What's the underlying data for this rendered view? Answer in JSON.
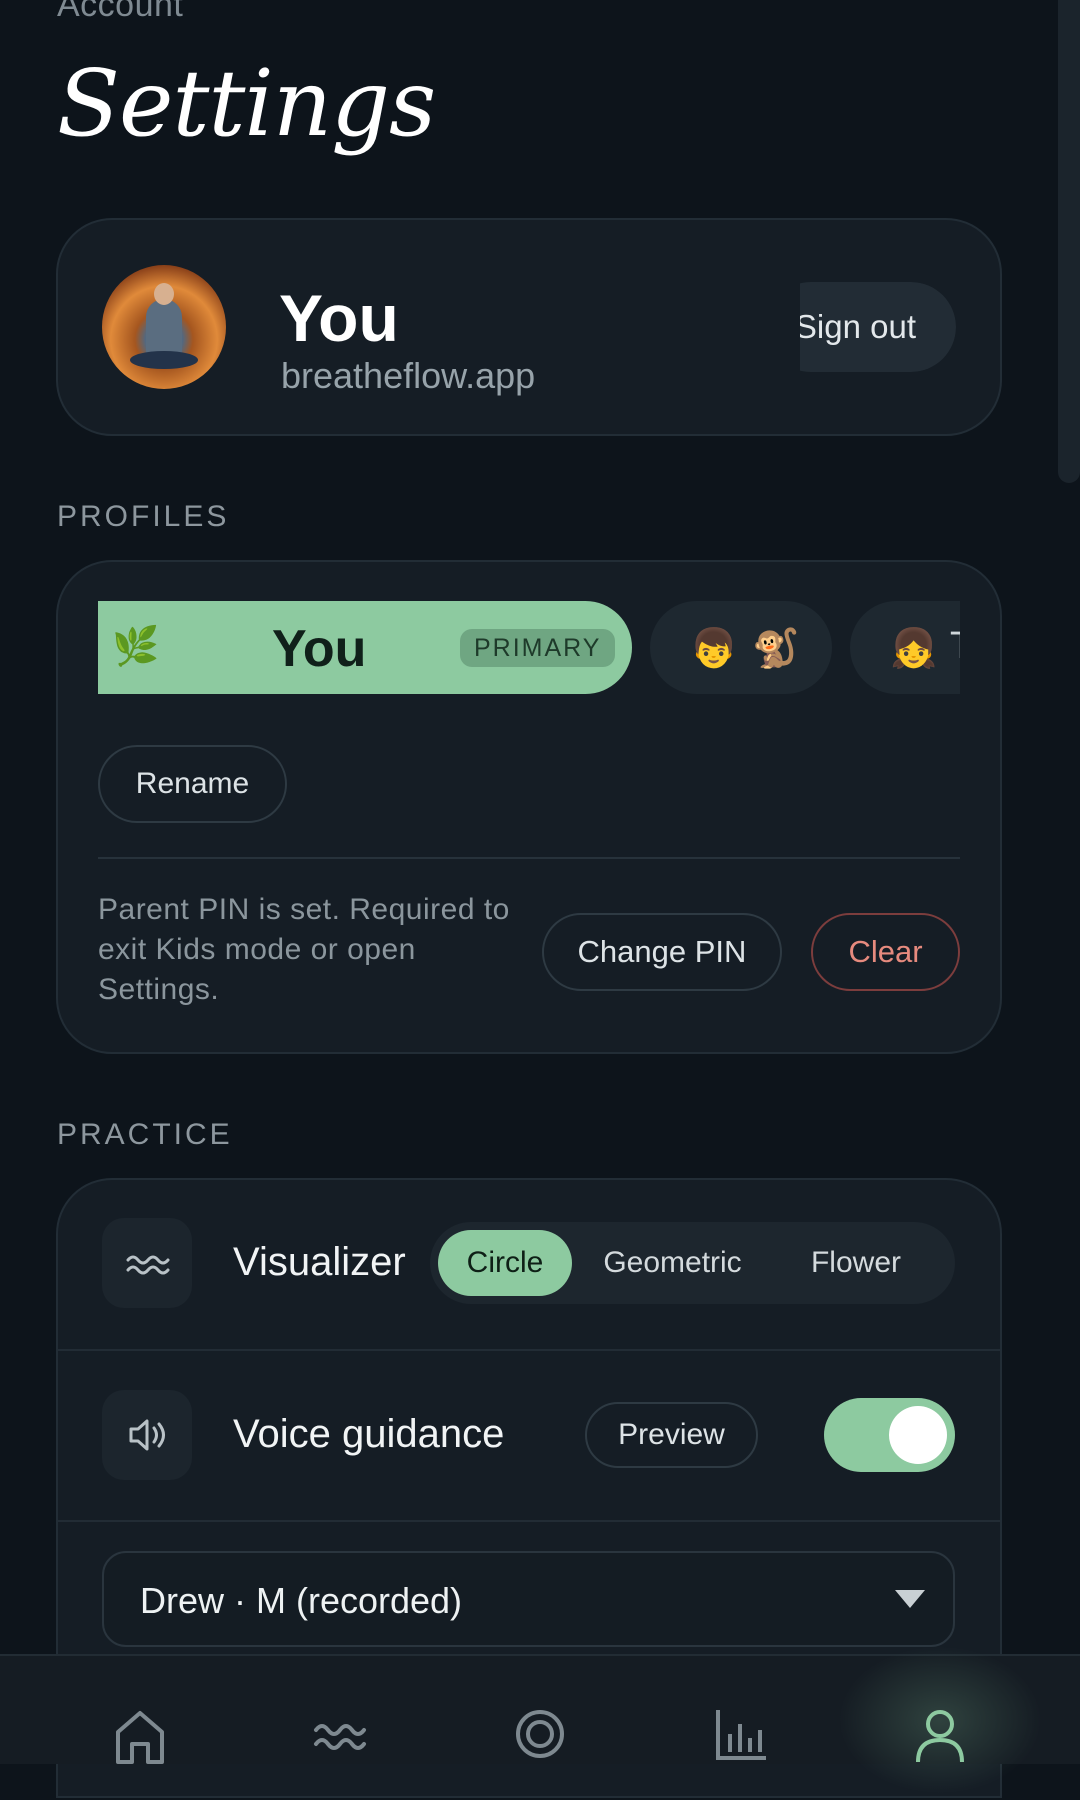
{
  "header": {
    "eyebrow": "Account",
    "title": "Settings"
  },
  "account": {
    "name": "You",
    "subtitle": "breatheflow.app",
    "sign_out_label": "Sign out"
  },
  "profiles": {
    "section_label": "PROFILES",
    "chips": [
      {
        "icon": "🌿",
        "name": "You",
        "badge": "PRIMARY",
        "selected": true
      },
      {
        "icons": [
          "👦",
          "🐒"
        ],
        "selected": false
      },
      {
        "icon": "👧",
        "name_partial": "T",
        "selected": false
      }
    ],
    "rename_label": "Rename",
    "pin_text": "Parent PIN is set. Required to exit Kids mode or open Settings.",
    "change_pin_label": "Change PIN",
    "clear_label": "Clear"
  },
  "practice": {
    "section_label": "PRACTICE",
    "visualizer": {
      "label": "Visualizer",
      "options": [
        "Circle",
        "Geometric",
        "Flower"
      ],
      "selected": "Circle"
    },
    "voice": {
      "label": "Voice guidance",
      "preview_label": "Preview",
      "enabled": true
    },
    "voice_select": {
      "value": "Drew · M (recorded)"
    }
  },
  "nav": {
    "items": [
      "home-icon",
      "breathe-wave-icon",
      "target-icon",
      "stats-icon",
      "profile-icon"
    ],
    "active": "profile-icon"
  },
  "colors": {
    "background": "#0d141b",
    "card": "#151d25",
    "accent": "#8dcaa0",
    "danger": "#e68a7e"
  }
}
